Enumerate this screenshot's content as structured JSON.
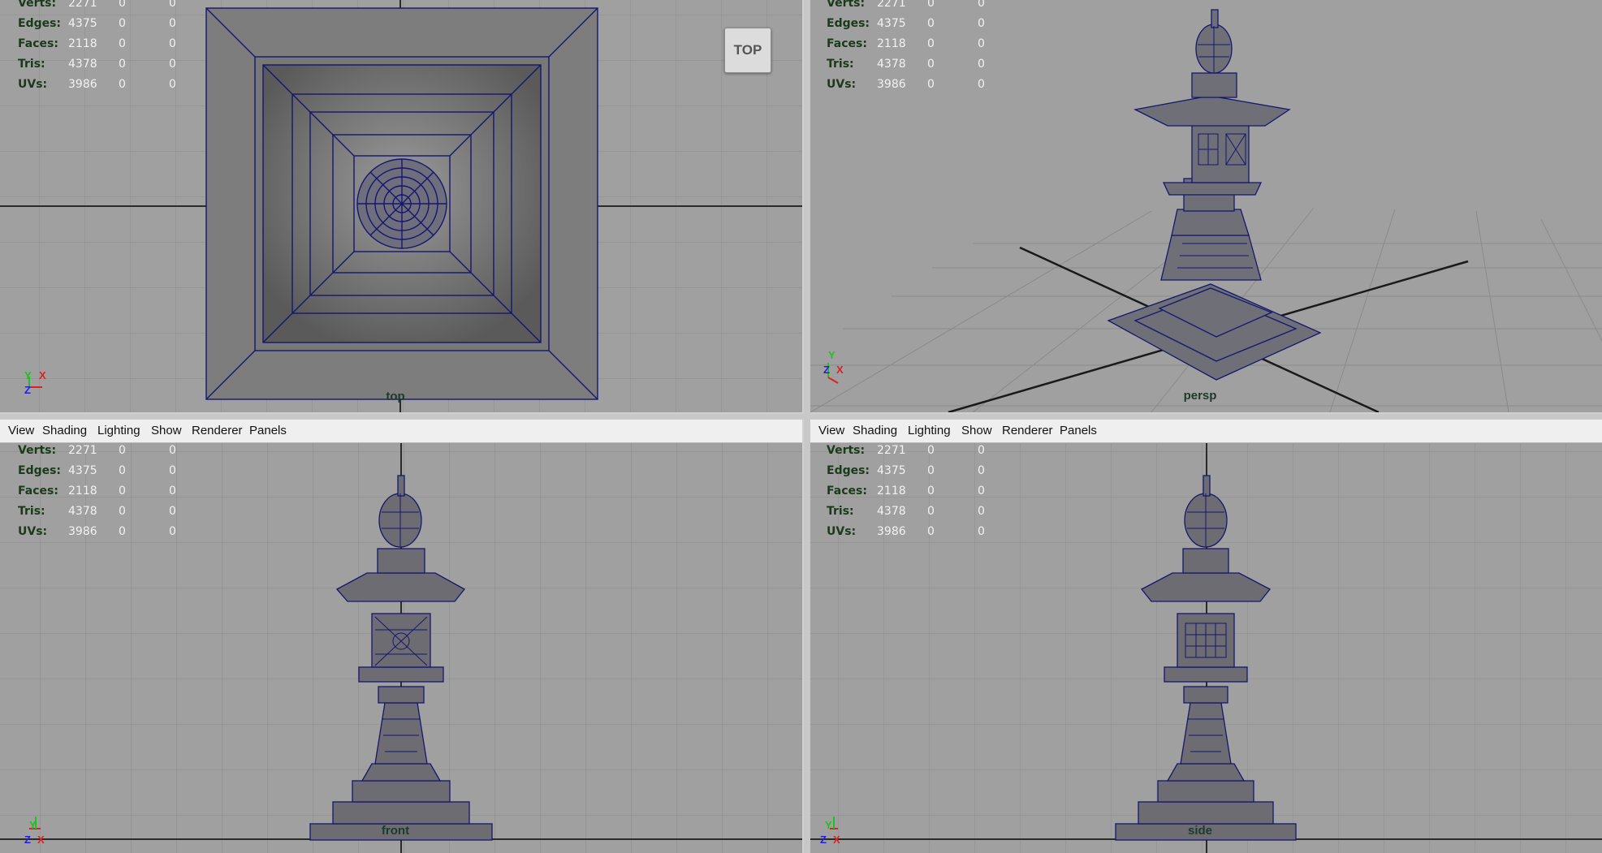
{
  "menu": [
    "View",
    "Shading",
    "Lighting",
    "Show",
    "Renderer",
    "Panels"
  ],
  "hud_rows": [
    {
      "label": "Verts:",
      "values": [
        "2271",
        "0",
        "0"
      ]
    },
    {
      "label": "Edges:",
      "values": [
        "4375",
        "0",
        "0"
      ]
    },
    {
      "label": "Faces:",
      "values": [
        "2118",
        "0",
        "0"
      ]
    },
    {
      "label": "Tris:",
      "values": [
        "4378",
        "0",
        "0"
      ]
    },
    {
      "label": "UVs:",
      "values": [
        "3986",
        "0",
        "0"
      ]
    }
  ],
  "viewports": {
    "top": {
      "label": "top",
      "cube_label": "TOP"
    },
    "persp": {
      "label": "persp"
    },
    "front": {
      "label": "front"
    },
    "side": {
      "label": "side"
    }
  },
  "axis_letters": {
    "x": "X",
    "y": "Y",
    "z": "Z"
  },
  "colors": {
    "viewport_bg": "#a0a0a0",
    "wire": "#16166e",
    "grid": "#8c8c8c",
    "axis_x": "#e02020",
    "axis_y": "#20c020",
    "axis_z": "#2020e0"
  }
}
